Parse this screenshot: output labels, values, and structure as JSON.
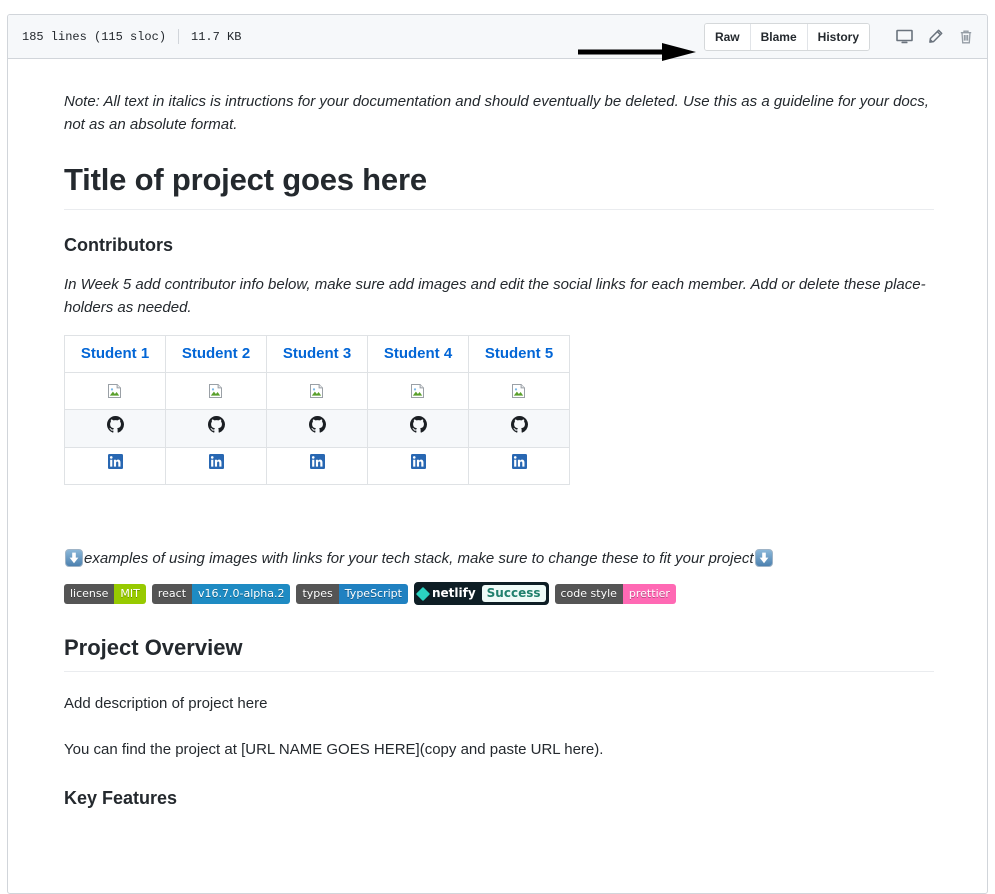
{
  "file_header": {
    "lines": "185 lines (115 sloc)",
    "size": "11.7 KB",
    "buttons": [
      {
        "label": "Raw",
        "name": "raw-button"
      },
      {
        "label": "Blame",
        "name": "blame-button"
      },
      {
        "label": "History",
        "name": "history-button"
      }
    ],
    "icons": [
      {
        "name": "desktop-icon",
        "title": "Open in desktop"
      },
      {
        "name": "pencil-icon",
        "title": "Edit this file"
      },
      {
        "name": "trash-icon",
        "title": "Delete this file"
      }
    ],
    "annotation": "black-right-arrow"
  },
  "content": {
    "note": "Note: All text in italics is intructions for your documentation and should eventually be deleted. Use this as a guideline for your docs, not as an absolute format.",
    "title": "Title of project goes here",
    "contributors_heading": "Contributors",
    "contributors_note": "In Week 5 add contributor info below, make sure add images and edit the social links for each member. Add or delete these place-holders as needed.",
    "contributors_table": {
      "headers": [
        "Student 1",
        "Student 2",
        "Student 3",
        "Student 4",
        "Student 5"
      ],
      "rows": [
        {
          "type": "image",
          "cells": [
            "broken-image-icon",
            "broken-image-icon",
            "broken-image-icon",
            "broken-image-icon",
            "broken-image-icon"
          ]
        },
        {
          "type": "github",
          "cells": [
            "github-icon",
            "github-icon",
            "github-icon",
            "github-icon",
            "github-icon"
          ]
        },
        {
          "type": "linkedin",
          "cells": [
            "linkedin-icon",
            "linkedin-icon",
            "linkedin-icon",
            "linkedin-icon",
            "linkedin-icon"
          ]
        }
      ]
    },
    "tech_stack_note": "examples of using images with links for your tech stack, make sure to change these to fit your project",
    "badges": [
      {
        "label": "license",
        "value": "MIT",
        "label_color": "#555555",
        "value_color": "#97ca00"
      },
      {
        "label": "react",
        "value": "v16.7.0-alpha.2",
        "label_color": "#555555",
        "value_color": "#1e8bc3"
      },
      {
        "label": "types",
        "value": "TypeScript",
        "label_color": "#555555",
        "value_color": "#2081c1"
      },
      {
        "label": "netlify",
        "value": "Success",
        "label_color": "#0e1e25",
        "value_color": "#effbf8",
        "style": "netlify"
      },
      {
        "label": "code style",
        "value": "prettier",
        "label_color": "#555555",
        "value_color": "#ff69b4"
      }
    ],
    "project_overview_heading": "Project Overview",
    "project_description": "Add description of project here",
    "project_url_line": "You can find the project at [URL NAME GOES HERE](copy and paste URL here).",
    "key_features_heading": "Key Features"
  },
  "colors": {
    "link": "#0366d6",
    "header_bg": "#f6f8fa",
    "border": "#d1d5da",
    "text": "#24292e",
    "table_stripe": "#f6f8fa"
  }
}
